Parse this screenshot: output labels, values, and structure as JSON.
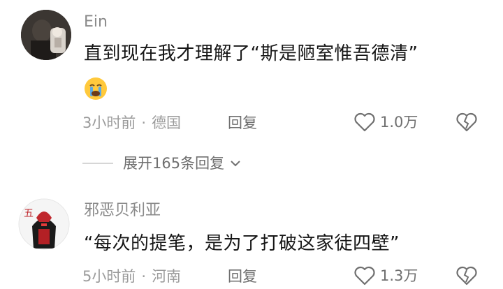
{
  "comments": [
    {
      "username": "Ein",
      "text": "直到现在我才理解了“斯是陋室惟吾德清”",
      "emoji": "crying-face-icon",
      "time": "3小时前",
      "location": "德国",
      "reply_label": "回复",
      "likes": "1.0万",
      "replies_expand": "展开165条回复"
    },
    {
      "username": "邪恶贝利亚",
      "text": "“每次的提笔，是为了打破这家徒四壁”",
      "time": "5小时前",
      "location": "河南",
      "reply_label": "回复",
      "likes": "1.3万"
    }
  ],
  "separator": "·",
  "colors": {
    "meta_gray": "#9b9b9b",
    "text": "#161616",
    "icon_gray": "#6f6f6f",
    "emoji_yellow": "#ffc93c",
    "tear_blue": "#5aa9e6"
  }
}
